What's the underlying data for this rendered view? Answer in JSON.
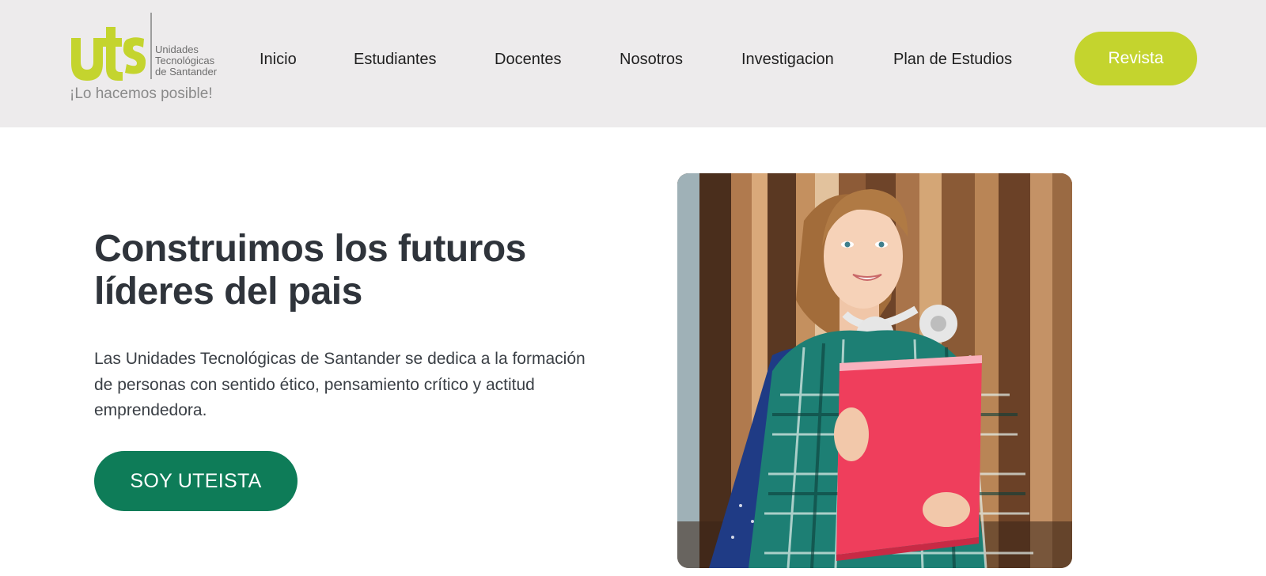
{
  "brand": {
    "mark": "uts",
    "name": "Unidades\nTecnológicas\nde Santander",
    "slogan": "¡Lo hacemos posible!",
    "colors": {
      "lime": "#c4d42e",
      "green": "#0e7c58",
      "header_bg": "#edebec"
    }
  },
  "nav": {
    "items": [
      {
        "label": "Inicio"
      },
      {
        "label": "Estudiantes"
      },
      {
        "label": "Docentes"
      },
      {
        "label": "Nosotros"
      },
      {
        "label": "Investigacion"
      },
      {
        "label": "Plan de Estudios"
      }
    ],
    "cta_label": "Revista"
  },
  "hero": {
    "title": "Construimos los futuros líderes del pais",
    "description": "Las Unidades Tecnológicas de Santander se dedica a la formación de personas con sentido ético, pensamiento crítico y actitud emprendedora.",
    "button_label": "SOY UTEISTA",
    "image_icon": "student-photo"
  }
}
